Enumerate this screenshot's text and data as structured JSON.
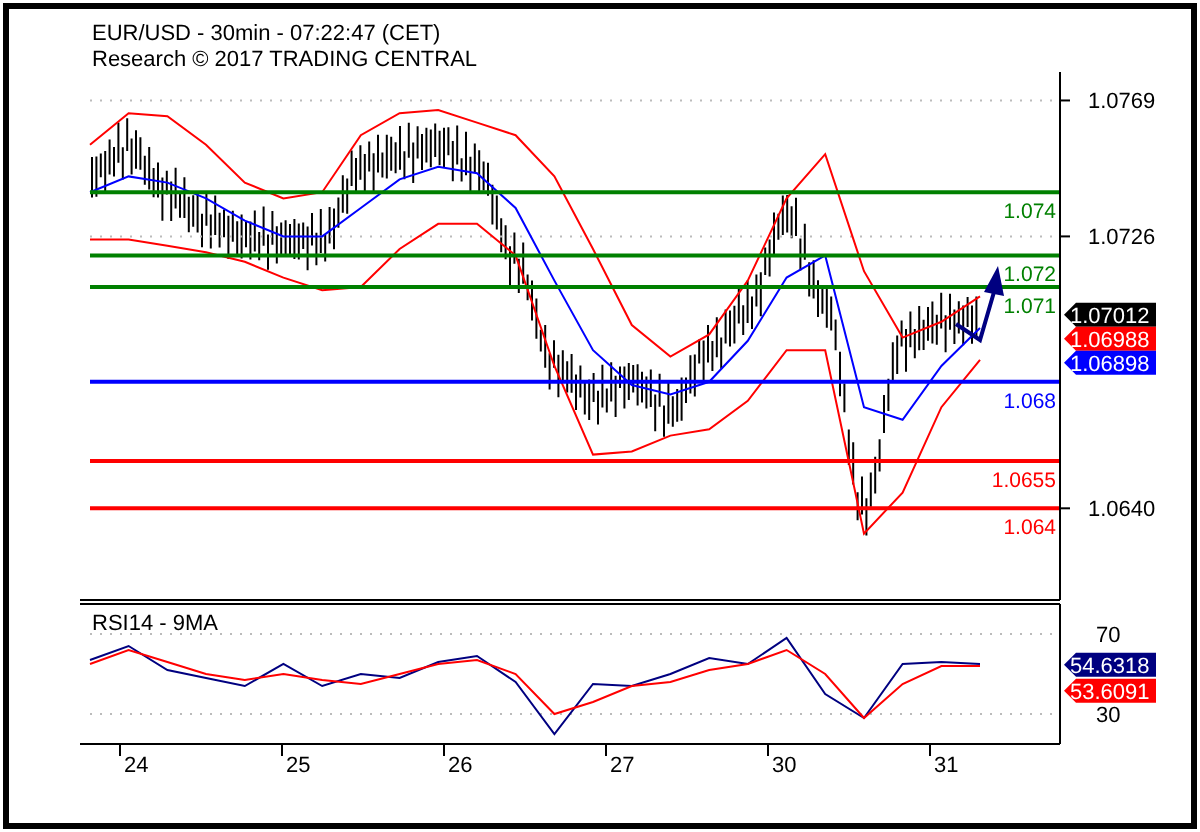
{
  "header": {
    "title": "EUR/USD - 30min - 07:22:47 (CET)",
    "subtitle": "Research © 2017 TRADING CENTRAL"
  },
  "price_chart": {
    "chart_data": {
      "type": "line",
      "ylim": [
        1.0611,
        1.0778
      ],
      "yticks": [
        {
          "value": 1.0769,
          "label": "1.0769"
        },
        {
          "value": 1.0726,
          "label": "1.0726"
        },
        {
          "value": 1.064,
          "label": "1.0640"
        }
      ],
      "series": [
        {
          "color": "#0000ff",
          "values": [
            1.074,
            1.0745,
            1.0743,
            1.0738,
            1.0731,
            1.0726,
            1.0726,
            1.0735,
            1.0744,
            1.0748,
            1.0746,
            1.0735,
            1.0712,
            1.069,
            1.0679,
            1.0676,
            1.068,
            1.0693,
            1.0713,
            1.072,
            1.0672,
            1.0668,
            1.0685,
            1.0697
          ]
        },
        {
          "color": "#ff0000",
          "values": [
            1.0755,
            1.0765,
            1.0764,
            1.0755,
            1.0743,
            1.0738,
            1.074,
            1.0758,
            1.0765,
            1.0766,
            1.0762,
            1.0758,
            1.0745,
            1.0722,
            1.0698,
            1.0688,
            1.0695,
            1.0712,
            1.0738,
            1.0752,
            1.0715,
            1.0694,
            1.0699,
            1.0707
          ]
        },
        {
          "color": "#ff0000",
          "values": [
            1.0725,
            1.0725,
            1.0723,
            1.0721,
            1.0718,
            1.0713,
            1.0709,
            1.071,
            1.0722,
            1.073,
            1.073,
            1.072,
            1.0685,
            1.0657,
            1.0658,
            1.0663,
            1.0665,
            1.0674,
            1.069,
            1.069,
            1.0632,
            1.0645,
            1.0672,
            1.0687
          ]
        }
      ],
      "ref_lines": [
        {
          "axis": "y",
          "value": 1.074,
          "label": "1.074",
          "color": "#008000"
        },
        {
          "axis": "y",
          "value": 1.072,
          "label": "1.072",
          "color": "#008000"
        },
        {
          "axis": "y",
          "value": 1.071,
          "label": "1.071",
          "color": "#008000"
        },
        {
          "axis": "y",
          "value": 1.068,
          "label": "1.068",
          "color": "#0000ff"
        },
        {
          "axis": "y",
          "value": 1.0655,
          "label": "1.0655",
          "color": "#ff0000"
        },
        {
          "axis": "y",
          "value": 1.064,
          "label": "1.064",
          "color": "#ff0000"
        }
      ]
    },
    "price_tags": [
      {
        "label": "1.07012",
        "color": "#000000"
      },
      {
        "label": "1.06988",
        "color": "#ff0000"
      },
      {
        "label": "1.06898",
        "color": "#0000ff"
      }
    ]
  },
  "rsi": {
    "title": "RSI14 - 9MA",
    "chart_data": {
      "type": "line",
      "ylim": [
        15,
        85
      ],
      "yticks": [
        70,
        30
      ],
      "series": [
        {
          "color": "#000080",
          "values": [
            57,
            64,
            52,
            48,
            44,
            55,
            44,
            50,
            48,
            56,
            59,
            46,
            20,
            45,
            44,
            50,
            58,
            55,
            68,
            40,
            28,
            55,
            56,
            55
          ]
        },
        {
          "color": "#ff0000",
          "values": [
            55,
            62,
            56,
            50,
            47,
            50,
            47,
            45,
            50,
            55,
            57,
            50,
            30,
            36,
            44,
            46,
            52,
            55,
            62,
            50,
            28,
            45,
            54,
            54
          ]
        }
      ]
    },
    "tags": [
      {
        "label": "54.6318",
        "color": "#000080"
      },
      {
        "label": "53.6091",
        "color": "#ff0000"
      }
    ]
  },
  "days": [
    "24",
    "25",
    "26",
    "27",
    "30",
    "31"
  ]
}
